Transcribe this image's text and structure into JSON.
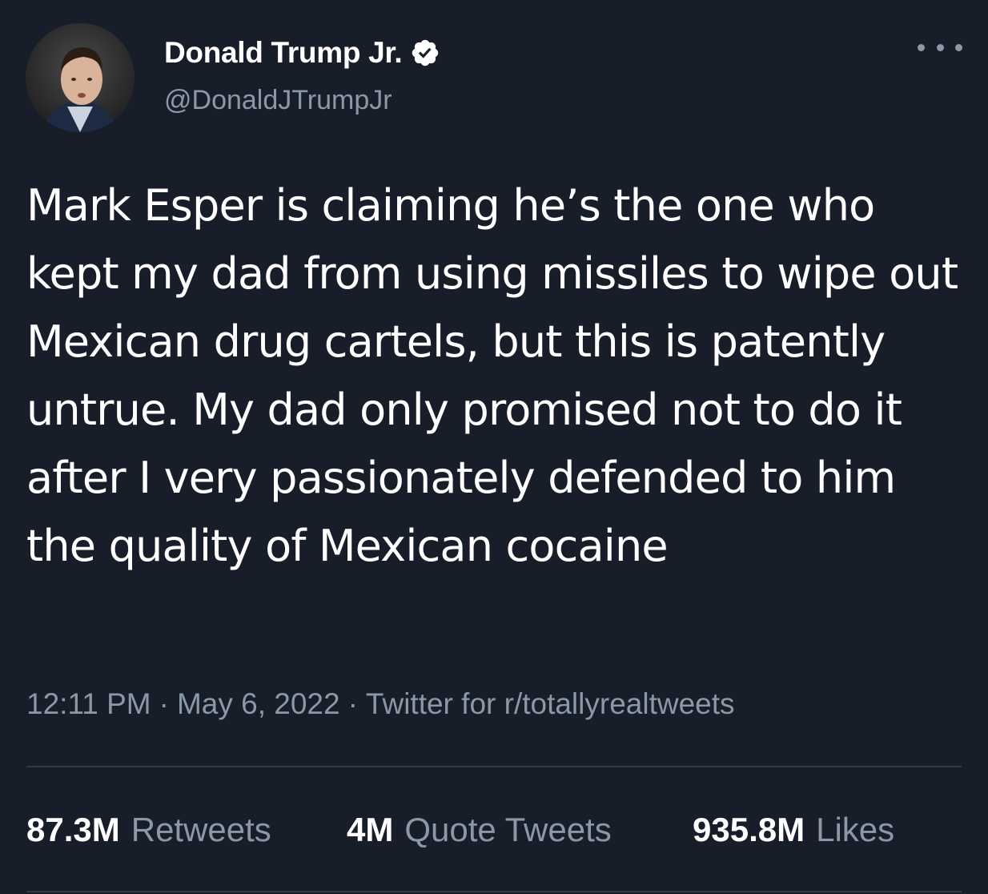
{
  "author": {
    "display_name": "Donald Trump Jr.",
    "handle": "@DonaldJTrumpJr",
    "verified": true
  },
  "icons": {
    "avatar": "profile-photo",
    "verified": "verified-badge-icon",
    "more": "more-options-icon"
  },
  "tweet": {
    "text": "Mark Esper is claiming he’s the one who kept my dad from using missiles to wipe out Mexican drug cartels, but this is patently untrue. My dad only promised not to do it after I very passionately defended to him the quality of Mexican cocaine",
    "time": "12:11 PM",
    "date": "May 6, 2022",
    "source": "Twitter for r/totallyrealtweets",
    "separator": "·"
  },
  "stats": {
    "retweets_count": "87.3M",
    "retweets_label": "Retweets",
    "quotes_count": "4M",
    "quotes_label": "Quote Tweets",
    "likes_count": "935.8M",
    "likes_label": "Likes"
  },
  "colors": {
    "background": "#171e29",
    "text_primary": "#ffffff",
    "text_secondary": "#8b98a5",
    "divider": "#2f3a46"
  }
}
